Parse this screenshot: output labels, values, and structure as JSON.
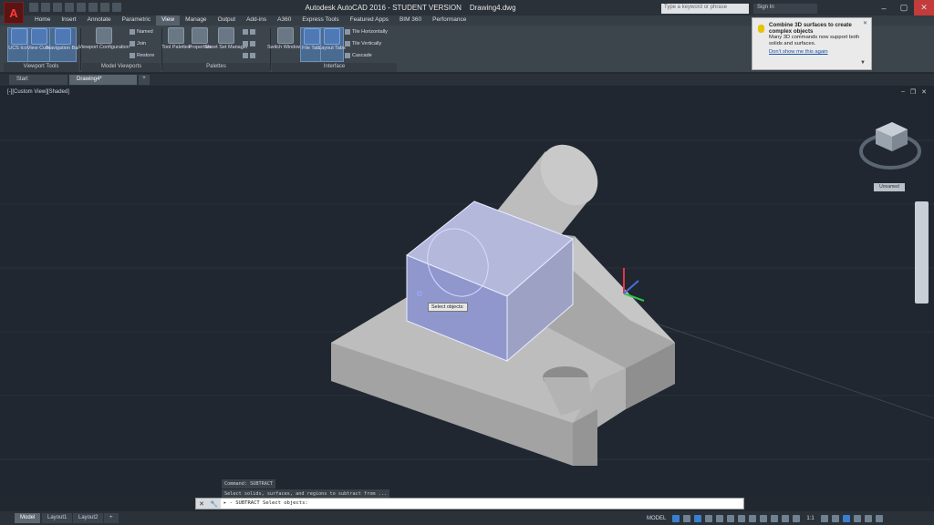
{
  "app": {
    "title": "Autodesk AutoCAD 2016 - STUDENT VERSION",
    "drawing": "Drawing4.dwg",
    "search_placeholder": "Type a keyword or phrase",
    "sign_in": "Sign In",
    "logo": "A"
  },
  "menu_tabs": [
    "Home",
    "Insert",
    "Annotate",
    "Parametric",
    "View",
    "Manage",
    "Output",
    "Add-ins",
    "A360",
    "Express Tools",
    "Featured Apps",
    "BIM 360",
    "Performance"
  ],
  "active_menu_tab": "View",
  "ribbon": {
    "viewport_tools": {
      "ucs_icon": "UCS Icon",
      "view_cube": "View Cube",
      "navigation_bar": "Navigation Bar",
      "label": "Viewport Tools"
    },
    "model_viewports": {
      "viewport_configuration": "Viewport Configuration",
      "named": "Named",
      "join": "Join",
      "restore": "Restore",
      "label": "Model Viewports"
    },
    "palettes": {
      "tool_palettes": "Tool Palettes",
      "properties": "Properties",
      "sheet_set_manager": "Sheet Set Manager",
      "label": "Palettes"
    },
    "interface": {
      "switch_windows": "Switch Windows",
      "file_tabs": "File Tabs",
      "layout_tabs": "Layout Tabs",
      "tile_horizontally": "Tile Horizontally",
      "tile_vertically": "Tile Vertically",
      "cascade": "Cascade",
      "label": "Interface"
    }
  },
  "tooltip": {
    "title": "Combine 3D surfaces to create complex objects",
    "body": "Many 3D commands now support both solids and surfaces.",
    "link": "Don't show me this again"
  },
  "file_tabs": {
    "start": "Start",
    "drawing": "Drawing4*"
  },
  "viewport": {
    "label": "[-][Custom View][Shaded]",
    "viewcube_label": "Unnamed",
    "select_tooltip": "Select objects:"
  },
  "command": {
    "history": [
      "Command: SUBTRACT",
      "Select solids, surfaces, and regions to subtract from ..."
    ],
    "prompt": "SUBTRACT Select objects:"
  },
  "layouts": {
    "model": "Model",
    "layout1": "Layout1",
    "layout2": "Layout2"
  },
  "status": {
    "model": "MODEL",
    "scale": "1:1"
  },
  "colors": {
    "background": "#202730",
    "selection": "#8c96d0",
    "ribbon": "#3c444c"
  }
}
